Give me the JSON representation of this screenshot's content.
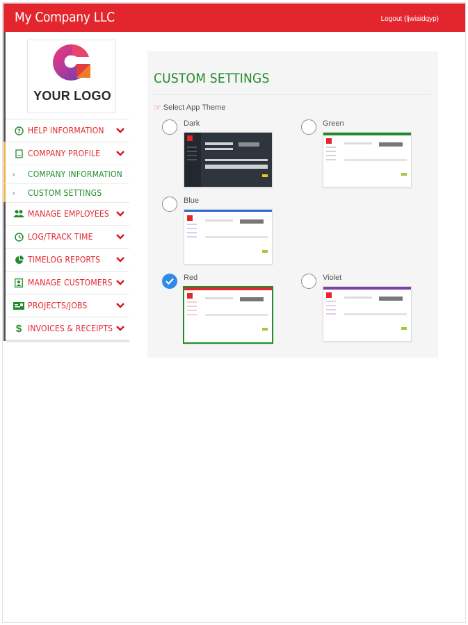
{
  "header": {
    "brand": "My Company LLC",
    "logout": "Logout (ljwiaidqyp)",
    "color": "#e3262e"
  },
  "sidebar": {
    "logo_text": "YOUR LOGO",
    "items": [
      {
        "label": "HELP INFORMATION",
        "icon": "question-circle-icon"
      },
      {
        "label": "COMPANY PROFILE",
        "icon": "document-icon"
      },
      {
        "label": "MANAGE EMPLOYEES",
        "icon": "users-icon"
      },
      {
        "label": "LOG/TRACK TIME",
        "icon": "clock-icon"
      },
      {
        "label": "TIMELOG REPORTS",
        "icon": "pie-chart-icon"
      },
      {
        "label": "MANAGE CUSTOMERS",
        "icon": "contact-card-icon"
      },
      {
        "label": "PROJECTS/JOBS",
        "icon": "id-card-icon"
      },
      {
        "label": "INVOICES & RECEIPTS",
        "icon": "dollar-icon"
      }
    ],
    "sub_items": [
      {
        "label": "COMPANY INFORMATION"
      },
      {
        "label": "CUSTOM SETTINGS"
      }
    ]
  },
  "settings": {
    "title": "CUSTOM SETTINGS",
    "select_label": "Select App Theme",
    "themes": [
      {
        "name": "Dark",
        "selected": false,
        "accent": "#333a44"
      },
      {
        "name": "Green",
        "selected": false,
        "accent": "#1e8c2a"
      },
      {
        "name": "Blue",
        "selected": false,
        "accent": "#2f6fd0"
      },
      {
        "name": "Red",
        "selected": true,
        "accent": "#e3262e"
      },
      {
        "name": "Violet",
        "selected": false,
        "accent": "#7e3fa8"
      }
    ]
  }
}
